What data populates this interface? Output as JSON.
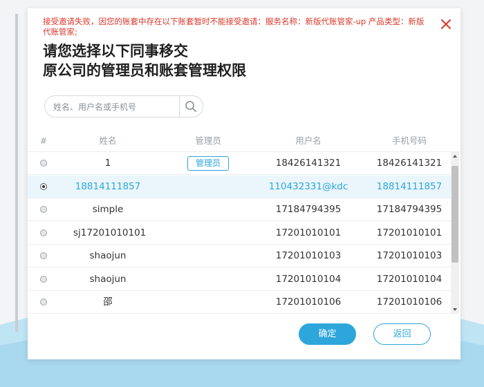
{
  "dialog": {
    "error_message": "接受邀请失败，因您的账套中存在以下账套暂时不能接受邀请：服务名称：新版代账管家-up 产品类型：新版代账管家;",
    "title_line1": "请您选择以下同事移交",
    "title_line2": "原公司的管理员和账套管理权限",
    "close_icon": "close-icon"
  },
  "search": {
    "placeholder": "姓名、用户名或手机号",
    "value": "",
    "icon": "search-icon"
  },
  "table": {
    "columns": [
      "#",
      "姓名",
      "管理员",
      "用户名",
      "手机号码"
    ],
    "admin_badge_label": "管理员",
    "rows": [
      {
        "name": "1",
        "is_admin": true,
        "username": "18426141321",
        "phone": "18426141321",
        "selected": false
      },
      {
        "name": "18814111857",
        "is_admin": false,
        "username": "110432331@kdc",
        "phone": "18814111857",
        "selected": true
      },
      {
        "name": "simple",
        "is_admin": false,
        "username": "17184794395",
        "phone": "17184794395",
        "selected": false
      },
      {
        "name": "sj17201010101",
        "is_admin": false,
        "username": "17201010101",
        "phone": "17201010101",
        "selected": false
      },
      {
        "name": "shaojun",
        "is_admin": false,
        "username": "17201010103",
        "phone": "17201010103",
        "selected": false
      },
      {
        "name": "shaojun",
        "is_admin": false,
        "username": "17201010104",
        "phone": "17201010104",
        "selected": false
      },
      {
        "name": "邵",
        "is_admin": false,
        "username": "17201010106",
        "phone": "17201010106",
        "selected": false
      }
    ]
  },
  "buttons": {
    "confirm_label": "确定",
    "back_label": "返回"
  },
  "colors": {
    "accent": "#2ea6dc",
    "error": "#d9362a",
    "selected_row": "#eaf6fb"
  }
}
